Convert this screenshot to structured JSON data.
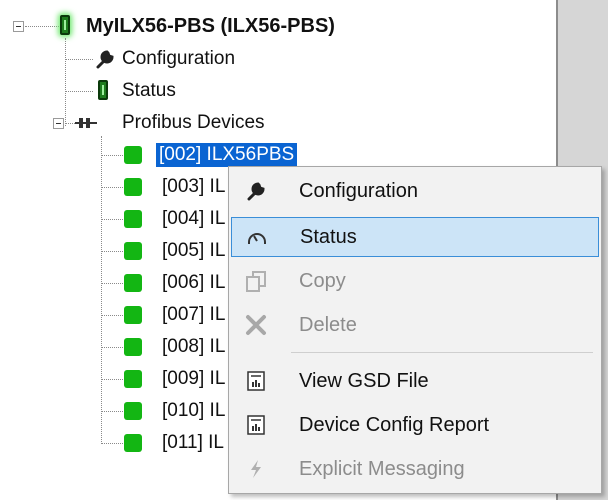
{
  "tree": {
    "root_label": "MyILX56-PBS (ILX56-PBS)",
    "configuration_label": "Configuration",
    "status_label": "Status",
    "profibus_label": "Profibus Devices",
    "devices": [
      {
        "label": "[002] ILX56PBS",
        "selected": true
      },
      {
        "label": "[003] IL",
        "selected": false
      },
      {
        "label": "[004] IL",
        "selected": false
      },
      {
        "label": "[005] IL",
        "selected": false
      },
      {
        "label": "[006] IL",
        "selected": false
      },
      {
        "label": "[007] IL",
        "selected": false
      },
      {
        "label": "[008] IL",
        "selected": false
      },
      {
        "label": "[009] IL",
        "selected": false
      },
      {
        "label": "[010] IL",
        "selected": false
      },
      {
        "label": "[011] IL",
        "selected": false
      }
    ]
  },
  "context_menu": {
    "items": [
      {
        "label": "Configuration",
        "icon": "wrench-icon",
        "enabled": true
      },
      {
        "label": "Status",
        "icon": "gauge-icon",
        "enabled": true,
        "highlighted": true
      },
      {
        "label": "Copy",
        "icon": "copy-icon",
        "enabled": false
      },
      {
        "label": "Delete",
        "icon": "delete-x-icon",
        "enabled": false
      },
      {
        "label": "View GSD File",
        "icon": "report-icon",
        "enabled": true
      },
      {
        "label": "Device Config Report",
        "icon": "report-icon",
        "enabled": true
      },
      {
        "label": "Explicit Messaging",
        "icon": "lightning-icon",
        "enabled": false
      }
    ]
  },
  "colors": {
    "selection": "#0a64d2",
    "menu_highlight": "#cce4f7",
    "device_green": "#13b613",
    "disabled_text": "#8c8c8c"
  }
}
